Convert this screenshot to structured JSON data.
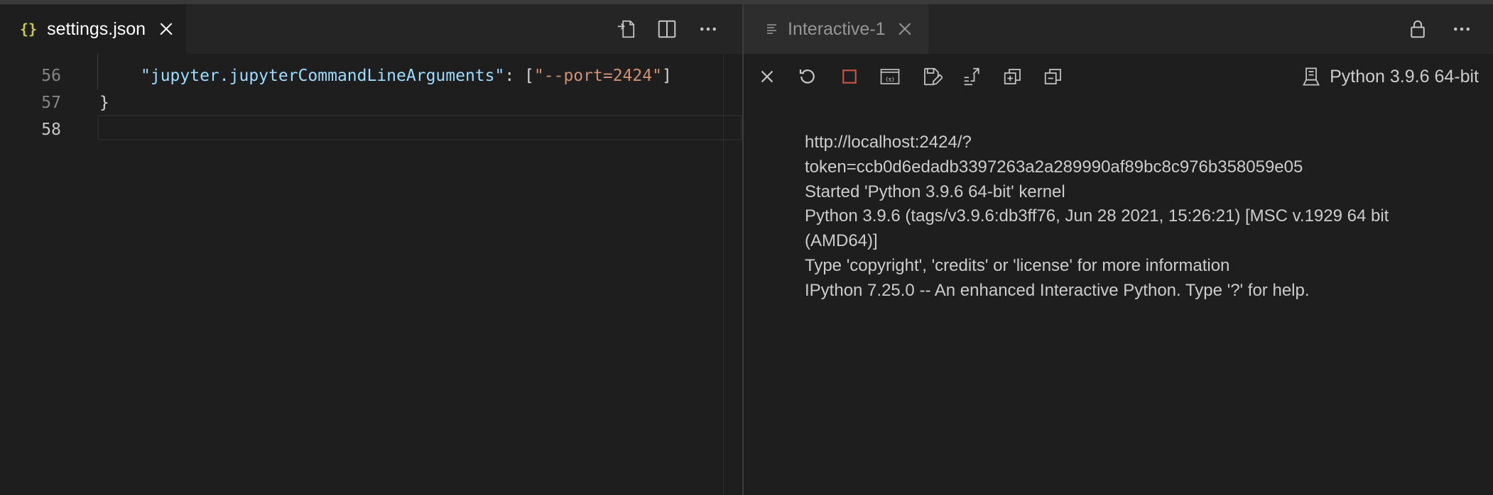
{
  "left_editor": {
    "tab": {
      "icon": "json-braces-icon",
      "icon_text": "{}",
      "label": "settings.json"
    },
    "actions": [
      "open-changes-icon",
      "split-editor-icon",
      "more-actions-icon"
    ],
    "lines": [
      {
        "number": "56",
        "key": "\"jupyter.jupyterCommandLineArguments\"",
        "colon": ": ",
        "open": "[",
        "value": "\"--port=2424\"",
        "close": "]"
      },
      {
        "number": "57",
        "text": "}"
      },
      {
        "number": "58",
        "text": ""
      }
    ]
  },
  "right_panel": {
    "tab": {
      "icon": "list-icon",
      "label": "Interactive-1"
    },
    "actions": [
      "lock-icon",
      "more-actions-icon"
    ],
    "toolbar": [
      "clear-all-icon",
      "restart-icon",
      "interrupt-icon",
      "variables-icon",
      "save-icon",
      "export-icon",
      "expand-all-icon",
      "collapse-all-icon"
    ],
    "kernel_label": "Python 3.9.6 64-bit",
    "output_lines": [
      "http://localhost:2424/?",
      "token=ccb0d6edadb3397263a2a289990af89bc8c976b358059e05",
      "Started 'Python 3.9.6 64-bit' kernel",
      "Python 3.9.6 (tags/v3.9.6:db3ff76, Jun 28 2021, 15:26:21) [MSC v.1929 64 bit",
      "(AMD64)]",
      "Type 'copyright', 'credits' or 'license' for more information",
      "IPython 7.25.0 -- An enhanced Interactive Python. Type '?' for help."
    ]
  },
  "colors": {
    "background": "#1e1e1e",
    "tabbar": "#252526",
    "json_key": "#9cdcfe",
    "json_string": "#ce9178",
    "json_icon": "#cbcb41"
  }
}
